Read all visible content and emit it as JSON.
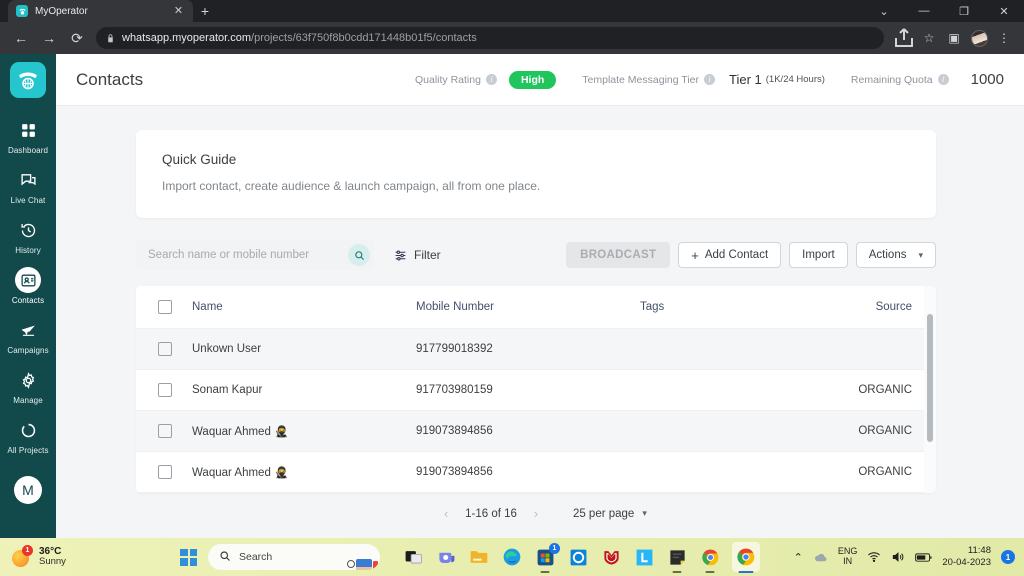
{
  "browser": {
    "tab": {
      "title": "MyOperator",
      "favicon": "myoperator-icon",
      "close_label": "✕"
    },
    "new_tab_label": "+",
    "window_controls": {
      "minimize": "—",
      "maximize": "❐",
      "close": "✕",
      "more": "⌄"
    },
    "nav": {
      "back": "←",
      "forward": "→",
      "reload": "⟳"
    },
    "url_domain": "whatsapp.myoperator.com",
    "url_path": "/projects/63f750f8b0cdd171448b01f5/contacts",
    "actions": {
      "share": "share-icon",
      "bookmark": "☆",
      "split": "▣",
      "profile": "avatar",
      "menu": "⋮"
    }
  },
  "sidebar": {
    "logo": "myoperator-logo",
    "items": [
      {
        "label": "Dashboard",
        "icon": "grid-icon",
        "active": false
      },
      {
        "label": "Live Chat",
        "icon": "chat-icon",
        "active": false
      },
      {
        "label": "History",
        "icon": "clock-history-icon",
        "active": false
      },
      {
        "label": "Contacts",
        "icon": "contact-card-icon",
        "active": true
      },
      {
        "label": "Campaigns",
        "icon": "paper-plane-icon",
        "active": false
      },
      {
        "label": "Manage",
        "icon": "gear-icon",
        "active": false
      },
      {
        "label": "All Projects",
        "icon": "circle-icon",
        "active": false
      }
    ],
    "user_initial": "M"
  },
  "header": {
    "title": "Contacts",
    "quality_rating_label": "Quality Rating",
    "quality_rating_value": "High",
    "quality_rating_color": "#21c55d",
    "template_tier_label": "Template Messaging Tier",
    "template_tier_value": "Tier 1",
    "template_tier_sub": "(1K/24 Hours)",
    "remaining_quota_label": "Remaining Quota",
    "remaining_quota_value": "1000"
  },
  "quick_guide": {
    "title": "Quick Guide",
    "description": "Import contact, create audience & launch campaign, all from one place."
  },
  "toolbar": {
    "search_placeholder": "Search name or mobile number",
    "search_value": "",
    "filter_label": "Filter",
    "broadcast_label": "BROADCAST",
    "add_contact_label": "Add Contact",
    "add_contact_plus": "+",
    "import_label": "Import",
    "actions_label": "Actions"
  },
  "table": {
    "columns": [
      "Name",
      "Mobile Number",
      "Tags",
      "Source"
    ],
    "rows": [
      {
        "name": "Unkown User",
        "emoji": "",
        "mobile": "917799018392",
        "tags": "",
        "source": ""
      },
      {
        "name": "Sonam Kapur",
        "emoji": "",
        "mobile": "917703980159",
        "tags": "",
        "source": "ORGANIC"
      },
      {
        "name": "Waquar Ahmed",
        "emoji": "🥷",
        "mobile": "919073894856",
        "tags": "",
        "source": "ORGANIC"
      },
      {
        "name": "Waquar Ahmed",
        "emoji": "🥷",
        "mobile": "919073894856",
        "tags": "",
        "source": "ORGANIC"
      }
    ]
  },
  "pagination": {
    "prev": "‹",
    "range": "1-16 of 16",
    "next": "›",
    "per_page": "25 per page"
  },
  "taskbar": {
    "weather_temp": "36°C",
    "weather_cond": "Sunny",
    "weather_badge": "1",
    "search_placeholder": "Search",
    "apps": [
      {
        "name": "task-view-icon",
        "badge": ""
      },
      {
        "name": "teams-icon",
        "badge": ""
      },
      {
        "name": "file-explorer-icon",
        "badge": ""
      },
      {
        "name": "edge-icon",
        "badge": ""
      },
      {
        "name": "microsoft-store-icon",
        "badge": "1"
      },
      {
        "name": "cortana-icon",
        "badge": ""
      },
      {
        "name": "mcafee-icon",
        "badge": ""
      },
      {
        "name": "l-app-icon",
        "badge": ""
      },
      {
        "name": "sticky-notes-icon",
        "badge": ""
      },
      {
        "name": "chrome-icon",
        "badge": ""
      },
      {
        "name": "chrome-active-icon",
        "badge": ""
      }
    ],
    "tray": {
      "chevron": "⌃",
      "onedrive": "onedrive-icon",
      "lang1": "ENG",
      "lang2": "IN",
      "wifi": "wifi-icon",
      "volume": "volume-icon",
      "battery": "battery-icon"
    },
    "time": "11:48",
    "date": "20-04-2023",
    "notification_count": "1"
  }
}
